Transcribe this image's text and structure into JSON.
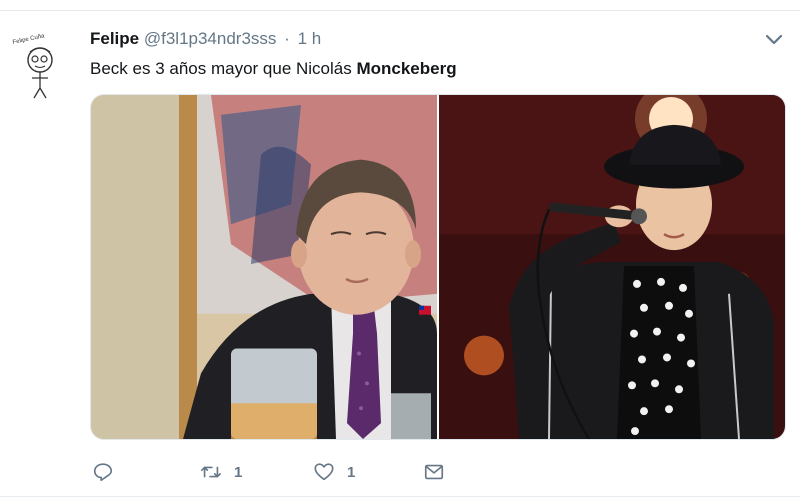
{
  "tweet": {
    "author_name": "Felipe",
    "author_handle": "@f3l1p34ndr3sss",
    "separator": "·",
    "time": "1 h",
    "text_plain": "Beck es 3 años mayor que Nicolás ",
    "text_bold": "Monckeberg",
    "avatar_text": "Felipe Cuña",
    "media": [
      {
        "kind": "photo",
        "position": "left"
      },
      {
        "kind": "photo",
        "position": "right"
      }
    ],
    "actions": {
      "reply_icon": "reply-icon",
      "retweet_icon": "retweet-icon",
      "retweet_count": "1",
      "like_icon": "heart-icon",
      "like_count": "1",
      "dm_icon": "envelope-icon"
    }
  },
  "colors": {
    "text": "#14171a",
    "secondary": "#657786",
    "border": "#e6ecf0"
  }
}
